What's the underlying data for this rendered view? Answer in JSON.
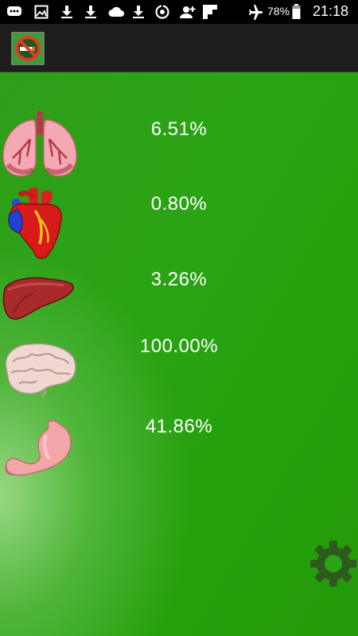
{
  "status_bar": {
    "battery_text": "78%",
    "time": "21:18",
    "icons": [
      "chat-icon",
      "image-icon",
      "download-icon",
      "download-icon",
      "cloud-icon",
      "download-icon",
      "sync-icon",
      "add-person-icon",
      "flipboard-icon",
      "airplane-mode-icon",
      "battery-icon"
    ]
  },
  "app_bar": {
    "icon": "no-smoking-icon"
  },
  "organs": [
    {
      "name": "lungs",
      "icon": "lungs-icon",
      "value": "6.51%"
    },
    {
      "name": "heart",
      "icon": "heart-icon",
      "value": "0.80%"
    },
    {
      "name": "liver",
      "icon": "liver-icon",
      "value": "3.26%"
    },
    {
      "name": "brain",
      "icon": "brain-icon",
      "value": "100.00%"
    },
    {
      "name": "stomach",
      "icon": "stomach-icon",
      "value": "41.86%"
    }
  ],
  "settings": {
    "icon": "gear-icon"
  },
  "colors": {
    "background_green": "#2aa414",
    "highlight_green": "#aee196",
    "gear": "#2f5a1f",
    "app_bar": "#1e1e1e",
    "status_bar": "#000000"
  }
}
